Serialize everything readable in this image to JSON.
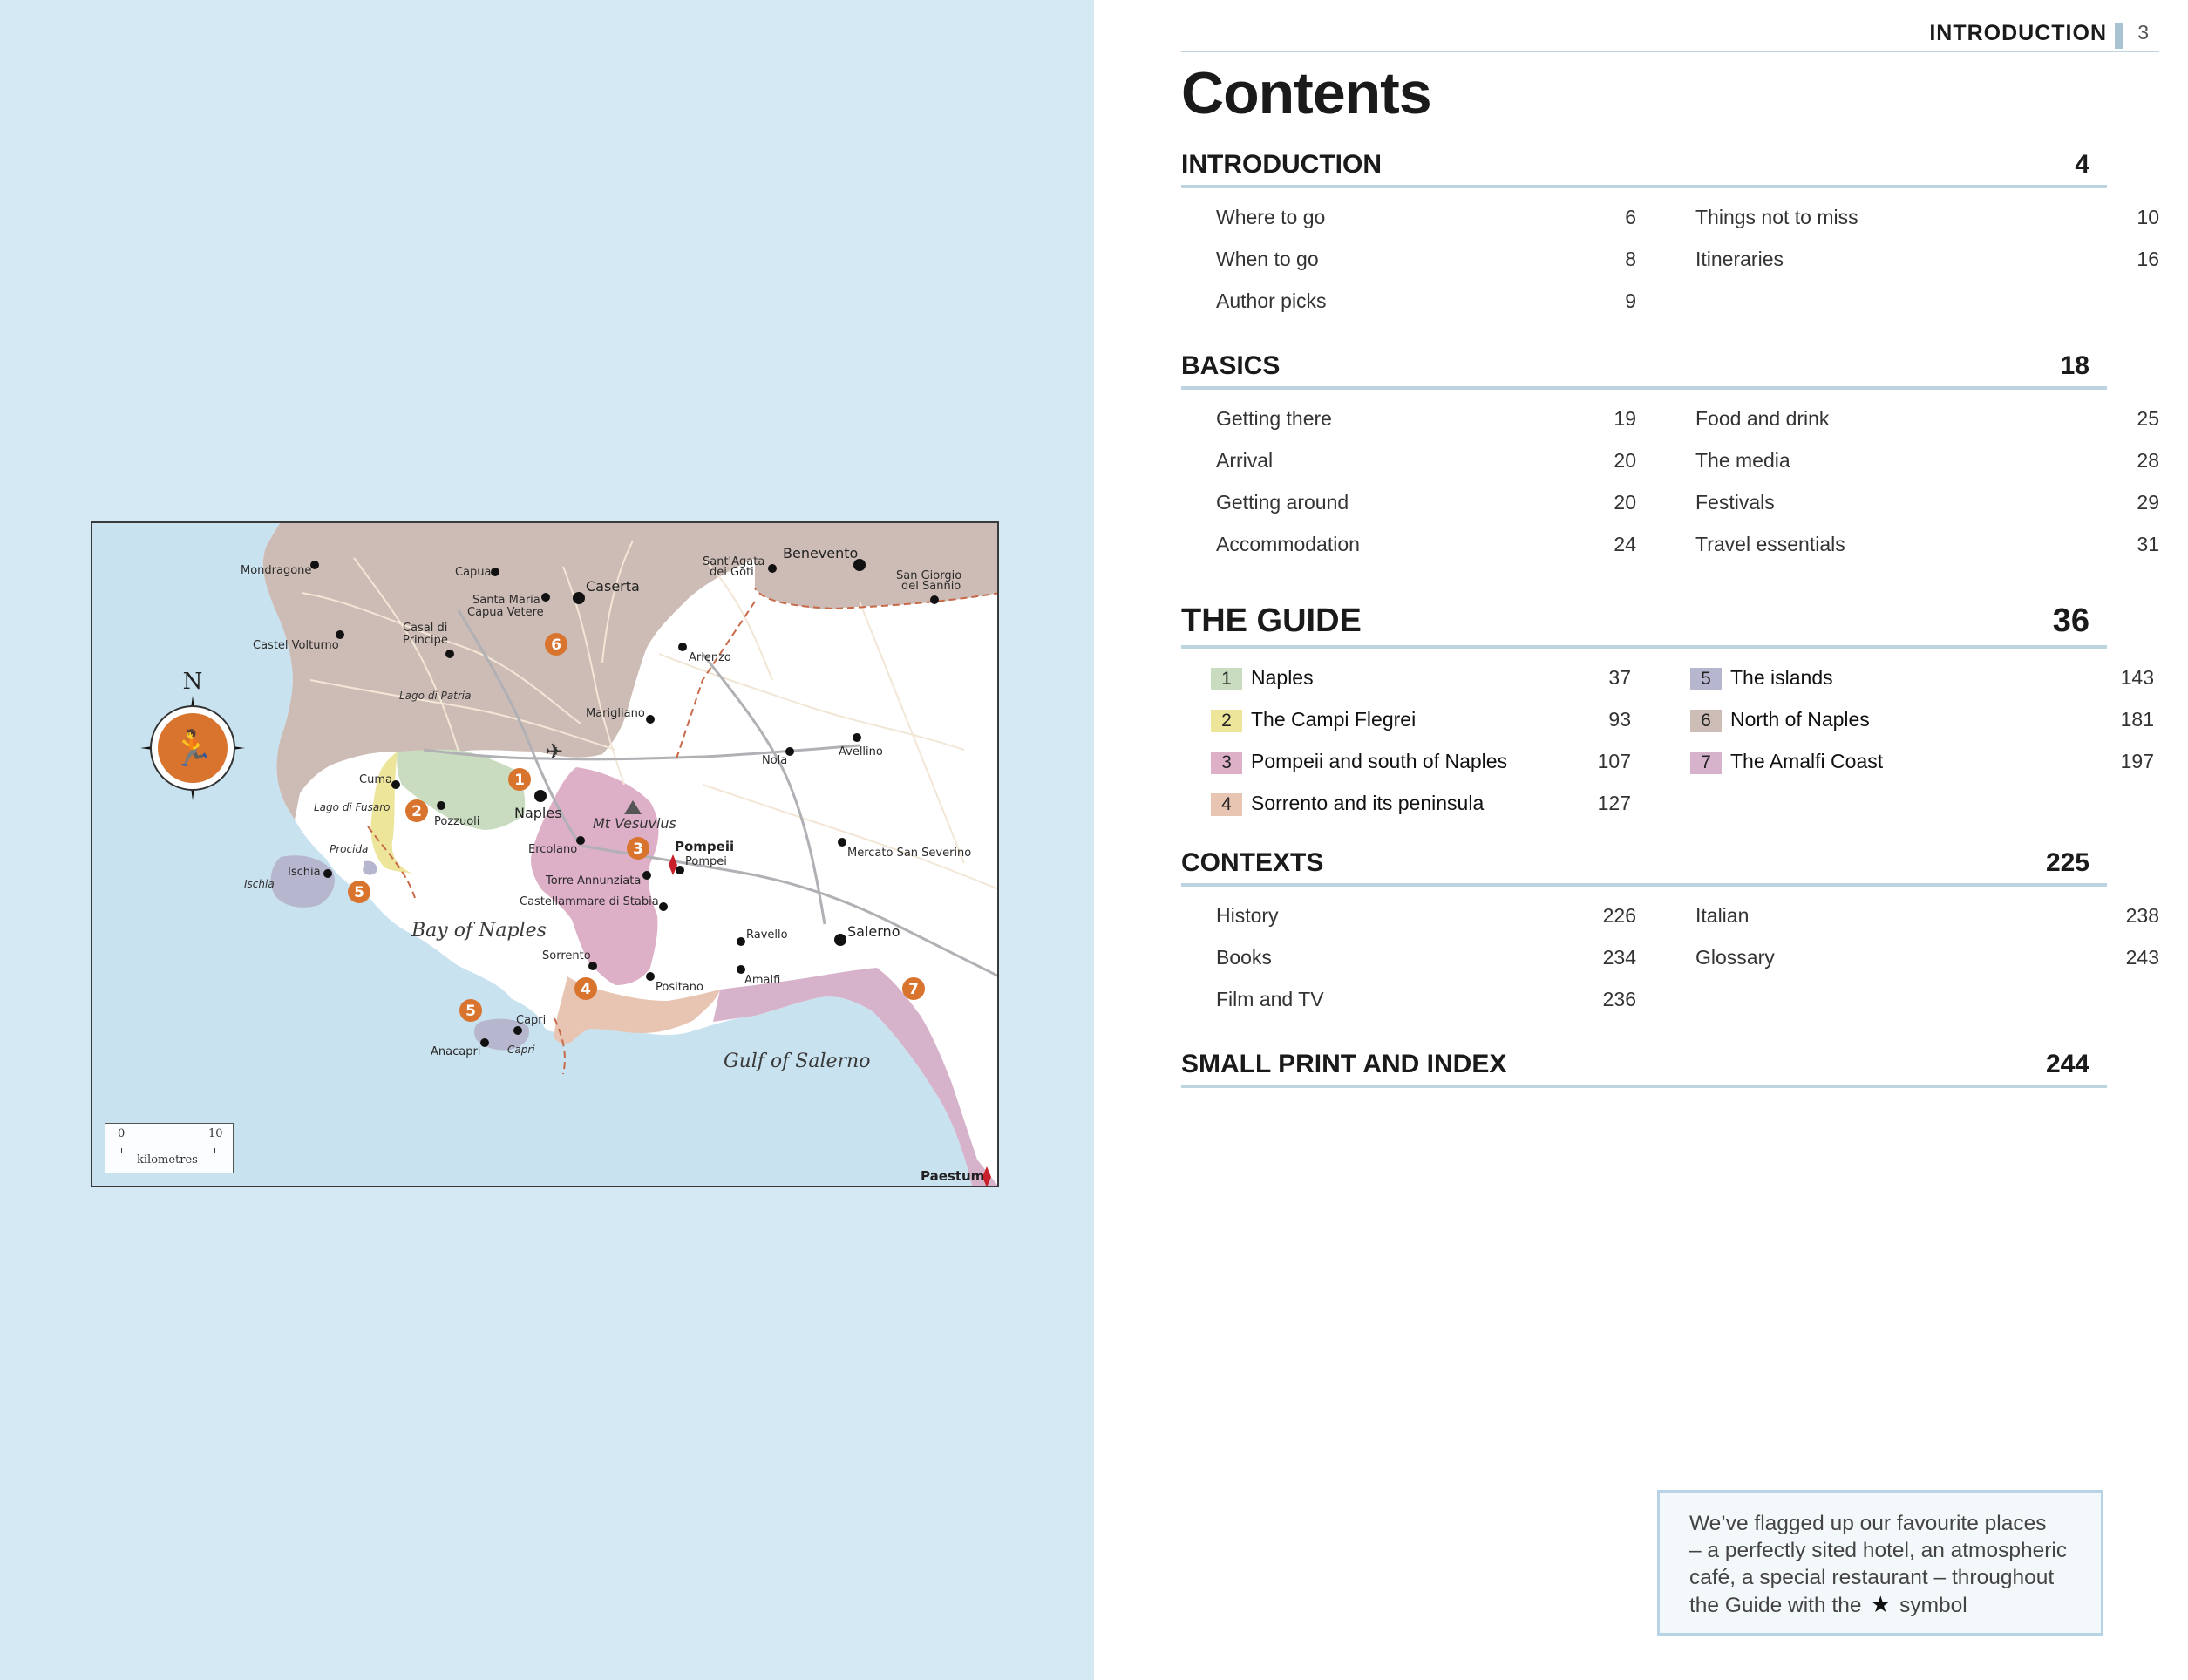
{
  "header": {
    "section": "INTRODUCTION",
    "page_number": "3"
  },
  "title": "Contents",
  "sections": [
    {
      "title": "INTRODUCTION",
      "page": "4",
      "col1": [
        {
          "name": "Where to go",
          "page": "6"
        },
        {
          "name": "When to go",
          "page": "8"
        },
        {
          "name": "Author picks",
          "page": "9"
        }
      ],
      "col2": [
        {
          "name": "Things not to miss",
          "page": "10"
        },
        {
          "name": "Itineraries",
          "page": "16"
        }
      ]
    },
    {
      "title": "BASICS",
      "page": "18",
      "col1": [
        {
          "name": "Getting there",
          "page": "19"
        },
        {
          "name": "Arrival",
          "page": "20"
        },
        {
          "name": "Getting around",
          "page": "20"
        },
        {
          "name": "Accommodation",
          "page": "24"
        }
      ],
      "col2": [
        {
          "name": "Food and drink",
          "page": "25"
        },
        {
          "name": "The media",
          "page": "28"
        },
        {
          "name": "Festivals",
          "page": "29"
        },
        {
          "name": "Travel essentials",
          "page": "31"
        }
      ]
    },
    {
      "title": "THE GUIDE",
      "page": "36",
      "col1": [
        {
          "num": "1",
          "name": "Naples",
          "page": "37",
          "color": "#c9dcc0"
        },
        {
          "num": "2",
          "name": "The Campi Flegrei",
          "page": "93",
          "color": "#ece59a"
        },
        {
          "num": "3",
          "name": "Pompeii and south of Naples",
          "page": "107",
          "color": "#ddb0c8"
        },
        {
          "num": "4",
          "name": "Sorrento and its peninsula",
          "page": "127",
          "color": "#e8c4b2"
        }
      ],
      "col2": [
        {
          "num": "5",
          "name": "The islands",
          "page": "143",
          "color": "#b6b6ce"
        },
        {
          "num": "6",
          "name": "North of Naples",
          "page": "181",
          "color": "#cdbdb6"
        },
        {
          "num": "7",
          "name": "The Amalfi Coast",
          "page": "197",
          "color": "#d7b3cb"
        }
      ]
    },
    {
      "title": "CONTEXTS",
      "page": "225",
      "col1": [
        {
          "name": "History",
          "page": "226"
        },
        {
          "name": "Books",
          "page": "234"
        },
        {
          "name": "Film and TV",
          "page": "236"
        }
      ],
      "col2": [
        {
          "name": "Italian",
          "page": "238"
        },
        {
          "name": "Glossary",
          "page": "243"
        }
      ]
    },
    {
      "title": "SMALL PRINT AND INDEX",
      "page": "244",
      "col1": [],
      "col2": []
    }
  ],
  "note": {
    "line1": "We’ve flagged up our favourite places",
    "line2": "– a perfectly sited hotel, an atmospheric",
    "line3": "café, a special restaurant – throughout",
    "line4": "the Guide with the",
    "line5": "symbol",
    "icon": "star-icon"
  },
  "map": {
    "compass_north": "N",
    "seas": [
      "Bay of Naples",
      "Gulf of Salerno"
    ],
    "volcano": "Mt Vesuvius",
    "scale": {
      "zero": "0",
      "ten": "10",
      "unit": "kilometres"
    },
    "towns": {
      "mondragone": "Mondragone",
      "capua": "Capua",
      "caserta": "Caserta",
      "santa_maria": "Santa Maria",
      "capua_vetere": "Capua Vetere",
      "santagata": "Sant'Agata",
      "dei_goti": "dei Goti",
      "benevento": "Benevento",
      "san_giorgio": "San Giorgio",
      "del_sannio": "del Sannio",
      "castel_volturno": "Castel Volturno",
      "casal_di": "Casal di",
      "principe": "Principe",
      "arienzo": "Arienzo",
      "lago_di_patria": "Lago di Patria",
      "marigliano": "Marigliano",
      "nola": "Nola",
      "avellino": "Avellino",
      "cuma": "Cuma",
      "lago_di_fusaro": "Lago di Fusaro",
      "pozzuoli": "Pozzuoli",
      "naples": "Naples",
      "procida": "Procida",
      "ischia_town": "Ischia",
      "ischia_island": "Ischia",
      "ercolano": "Ercolano",
      "pompeii": "Pompeii",
      "pompei": "Pompei",
      "mercato_san_severino": "Mercato San Severino",
      "torre_annunziata": "Torre Annunziata",
      "castellammare": "Castellammare di Stabia",
      "ravello": "Ravello",
      "salerno": "Salerno",
      "sorrento": "Sorrento",
      "positano": "Positano",
      "amalfi": "Amalfi",
      "capri_town": "Capri",
      "anacapri": "Anacapri",
      "capri_island": "Capri",
      "paestum": "Paestum"
    }
  }
}
